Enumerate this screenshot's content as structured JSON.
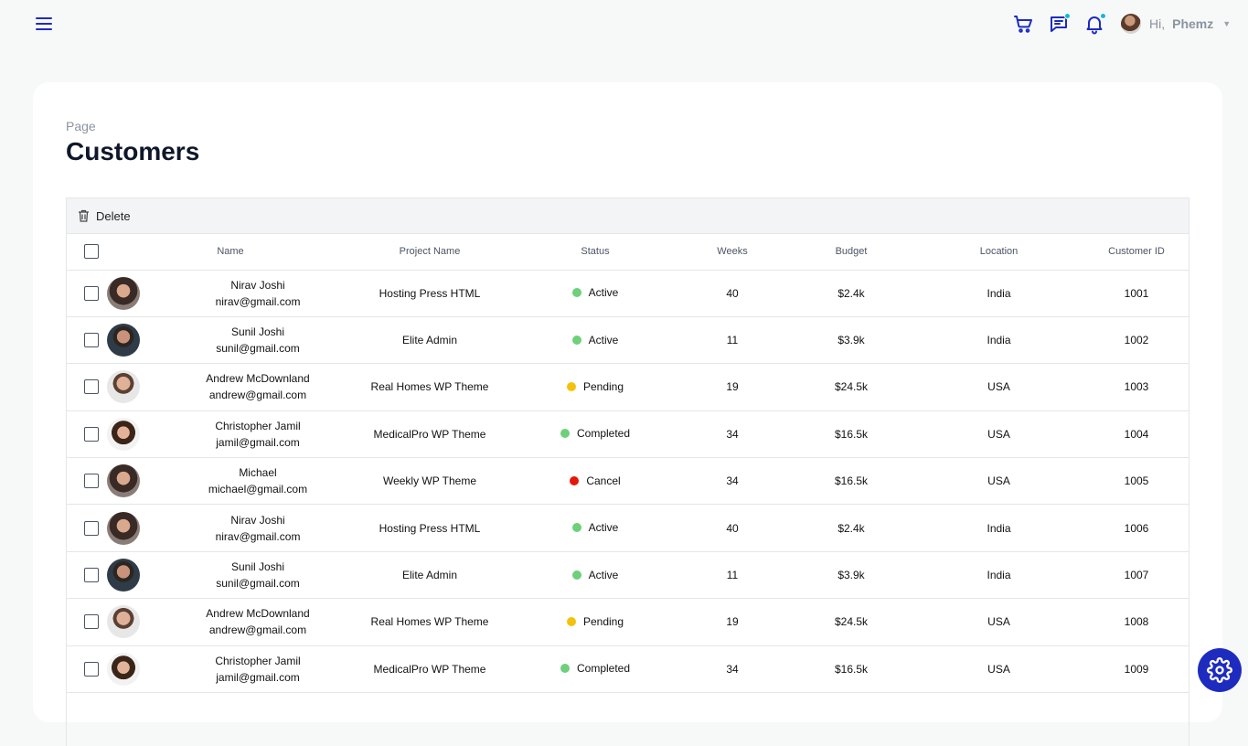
{
  "header": {
    "greeting": "Hi,",
    "user_name": "Phemz",
    "icons": [
      "menu-icon",
      "cart-icon",
      "chat-icon",
      "bell-icon"
    ],
    "accent": "#1e2bbf",
    "badge_color": "#15b7d9"
  },
  "page": {
    "breadcrumb": "Page",
    "title": "Customers"
  },
  "toolbar": {
    "delete_label": "Delete"
  },
  "table": {
    "columns": [
      "Name",
      "Project Name",
      "Status",
      "Weeks",
      "Budget",
      "Location",
      "Customer ID"
    ],
    "rows": [
      {
        "name": "Nirav Joshi",
        "email": "nirav@gmail.com",
        "project": "Hosting Press HTML",
        "status": "Active",
        "status_color": "#6ed07a",
        "weeks": "40",
        "budget": "$2.4k",
        "location": "India",
        "id": "1001",
        "avatar": "woman"
      },
      {
        "name": "Sunil Joshi",
        "email": "sunil@gmail.com",
        "project": "Elite Admin",
        "status": "Active",
        "status_color": "#6ed07a",
        "weeks": "11",
        "budget": "$3.9k",
        "location": "India",
        "id": "1002",
        "avatar": "man-dark"
      },
      {
        "name": "Andrew McDownland",
        "email": "andrew@gmail.com",
        "project": "Real Homes WP Theme",
        "status": "Pending",
        "status_color": "#f4c20d",
        "weeks": "19",
        "budget": "$24.5k",
        "location": "USA",
        "id": "1003",
        "avatar": "man-light"
      },
      {
        "name": "Christopher Jamil",
        "email": "jamil@gmail.com",
        "project": "MedicalPro WP Theme",
        "status": "Completed",
        "status_color": "#6ed07a",
        "weeks": "34",
        "budget": "$16.5k",
        "location": "USA",
        "id": "1004",
        "avatar": "man-curly"
      },
      {
        "name": "Michael",
        "email": "michael@gmail.com",
        "project": "Weekly WP Theme",
        "status": "Cancel",
        "status_color": "#e3170a",
        "weeks": "34",
        "budget": "$16.5k",
        "location": "USA",
        "id": "1005",
        "avatar": "woman"
      },
      {
        "name": "Nirav Joshi",
        "email": "nirav@gmail.com",
        "project": "Hosting Press HTML",
        "status": "Active",
        "status_color": "#6ed07a",
        "weeks": "40",
        "budget": "$2.4k",
        "location": "India",
        "id": "1006",
        "avatar": "woman"
      },
      {
        "name": "Sunil Joshi",
        "email": "sunil@gmail.com",
        "project": "Elite Admin",
        "status": "Active",
        "status_color": "#6ed07a",
        "weeks": "11",
        "budget": "$3.9k",
        "location": "India",
        "id": "1007",
        "avatar": "man-dark"
      },
      {
        "name": "Andrew McDownland",
        "email": "andrew@gmail.com",
        "project": "Real Homes WP Theme",
        "status": "Pending",
        "status_color": "#f4c20d",
        "weeks": "19",
        "budget": "$24.5k",
        "location": "USA",
        "id": "1008",
        "avatar": "man-light"
      },
      {
        "name": "Christopher Jamil",
        "email": "jamil@gmail.com",
        "project": "MedicalPro WP Theme",
        "status": "Completed",
        "status_color": "#6ed07a",
        "weeks": "34",
        "budget": "$16.5k",
        "location": "USA",
        "id": "1009",
        "avatar": "man-curly"
      }
    ]
  }
}
